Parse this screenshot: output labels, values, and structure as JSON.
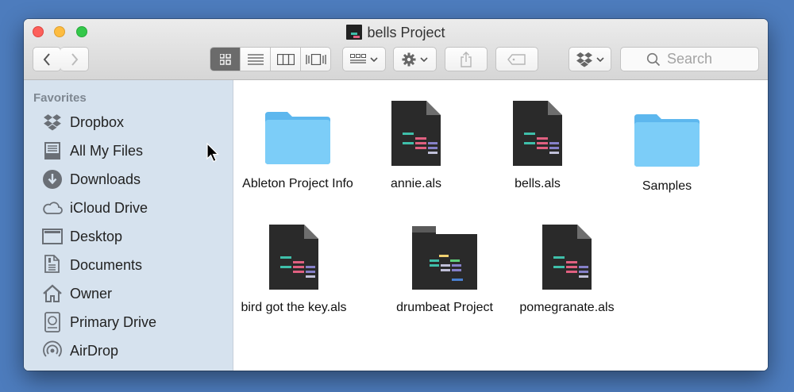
{
  "window": {
    "title": "bells Project"
  },
  "toolbar": {
    "view_modes": [
      "icon-view-icon",
      "list-view-icon",
      "column-view-icon",
      "cover-flow-icon"
    ],
    "active_view": "icon"
  },
  "search": {
    "placeholder": "Search"
  },
  "sidebar": {
    "heading": "Favorites",
    "items": [
      {
        "label": "Dropbox",
        "icon": "dropbox-icon"
      },
      {
        "label": "All My Files",
        "icon": "all-files-icon"
      },
      {
        "label": "Downloads",
        "icon": "downloads-icon"
      },
      {
        "label": "iCloud Drive",
        "icon": "cloud-icon"
      },
      {
        "label": "Desktop",
        "icon": "desktop-icon"
      },
      {
        "label": "Documents",
        "icon": "documents-icon"
      },
      {
        "label": "Owner",
        "icon": "home-icon"
      },
      {
        "label": "Primary Drive",
        "icon": "drive-icon"
      },
      {
        "label": "AirDrop",
        "icon": "airdrop-icon"
      }
    ]
  },
  "files": [
    {
      "name": "Ableton Project Info",
      "kind": "folder"
    },
    {
      "name": "annie.als",
      "kind": "als"
    },
    {
      "name": "bells.als",
      "kind": "als"
    },
    {
      "name": "Samples",
      "kind": "folder"
    },
    {
      "name": "bird got the key.als",
      "kind": "als"
    },
    {
      "name": "drumbeat Project",
      "kind": "project"
    },
    {
      "name": "pomegranate.als",
      "kind": "als"
    }
  ],
  "colors": {
    "sidebar_bg": "#d6e2ee",
    "folder_blue": "#6ec4f5",
    "als_dark": "#2a2a2a",
    "teal": "#3fbfaa",
    "pink": "#e06080",
    "purple": "#8580c8",
    "yellow": "#f0d070",
    "green": "#5fcf7a"
  }
}
